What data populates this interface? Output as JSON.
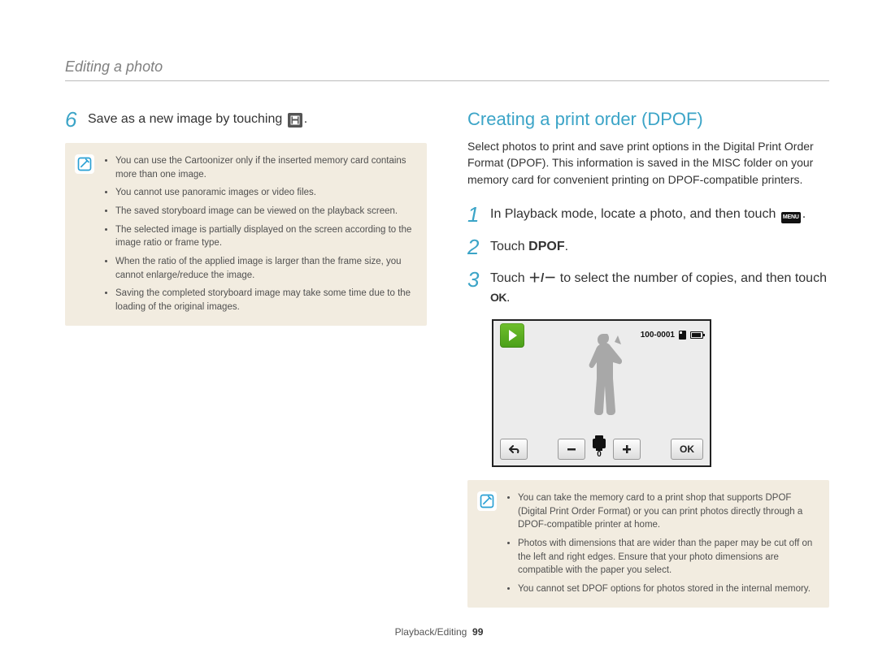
{
  "breadcrumb": "Editing a photo",
  "left": {
    "step_num": "6",
    "step_text_prefix": "Save as a new image by touching ",
    "step_text_suffix": ".",
    "notes": [
      "You can use the Cartoonizer only if the inserted memory card contains more than one image.",
      "You cannot use panoramic images or video files.",
      "The saved storyboard image can be viewed on the playback screen.",
      "The selected image is partially displayed on the screen according to the image ratio or frame type.",
      "When the ratio of the applied image is larger than the frame size, you cannot enlarge/reduce the image.",
      "Saving the completed storyboard image may take some time due to the loading of the original images."
    ]
  },
  "right": {
    "heading": "Creating a print order (DPOF)",
    "intro": "Select photos to print and save print options in the Digital Print Order Format (DPOF). This information is saved in the MISC folder on your memory card for convenient printing on DPOF-compatible printers.",
    "steps": {
      "s1_prefix": "In Playback mode, locate a photo, and then touch ",
      "s1_suffix": ".",
      "s2_prefix": "Touch ",
      "s2_bold": "DPOF",
      "s2_suffix": ".",
      "s3_prefix": "Touch ",
      "s3_mid": " to select the number of copies, and then touch ",
      "s3_suffix": "."
    },
    "screenshot": {
      "file_counter": "100-0001",
      "copies": "0",
      "ok": "OK"
    },
    "notes": [
      "You can take the memory card to a print shop that supports DPOF (Digital Print Order Format) or you can print photos directly through a DPOF-compatible printer at home.",
      "Photos with dimensions that are wider than the paper may be cut off on the left and right edges. Ensure that your photo dimensions are compatible with the paper you select.",
      "You cannot set DPOF options for photos stored in the internal memory."
    ]
  },
  "footer": {
    "section": "Playback/Editing",
    "page": "99"
  },
  "icons": {
    "menu": "MENU",
    "ok": "OK",
    "plusminus": "＋/－"
  }
}
